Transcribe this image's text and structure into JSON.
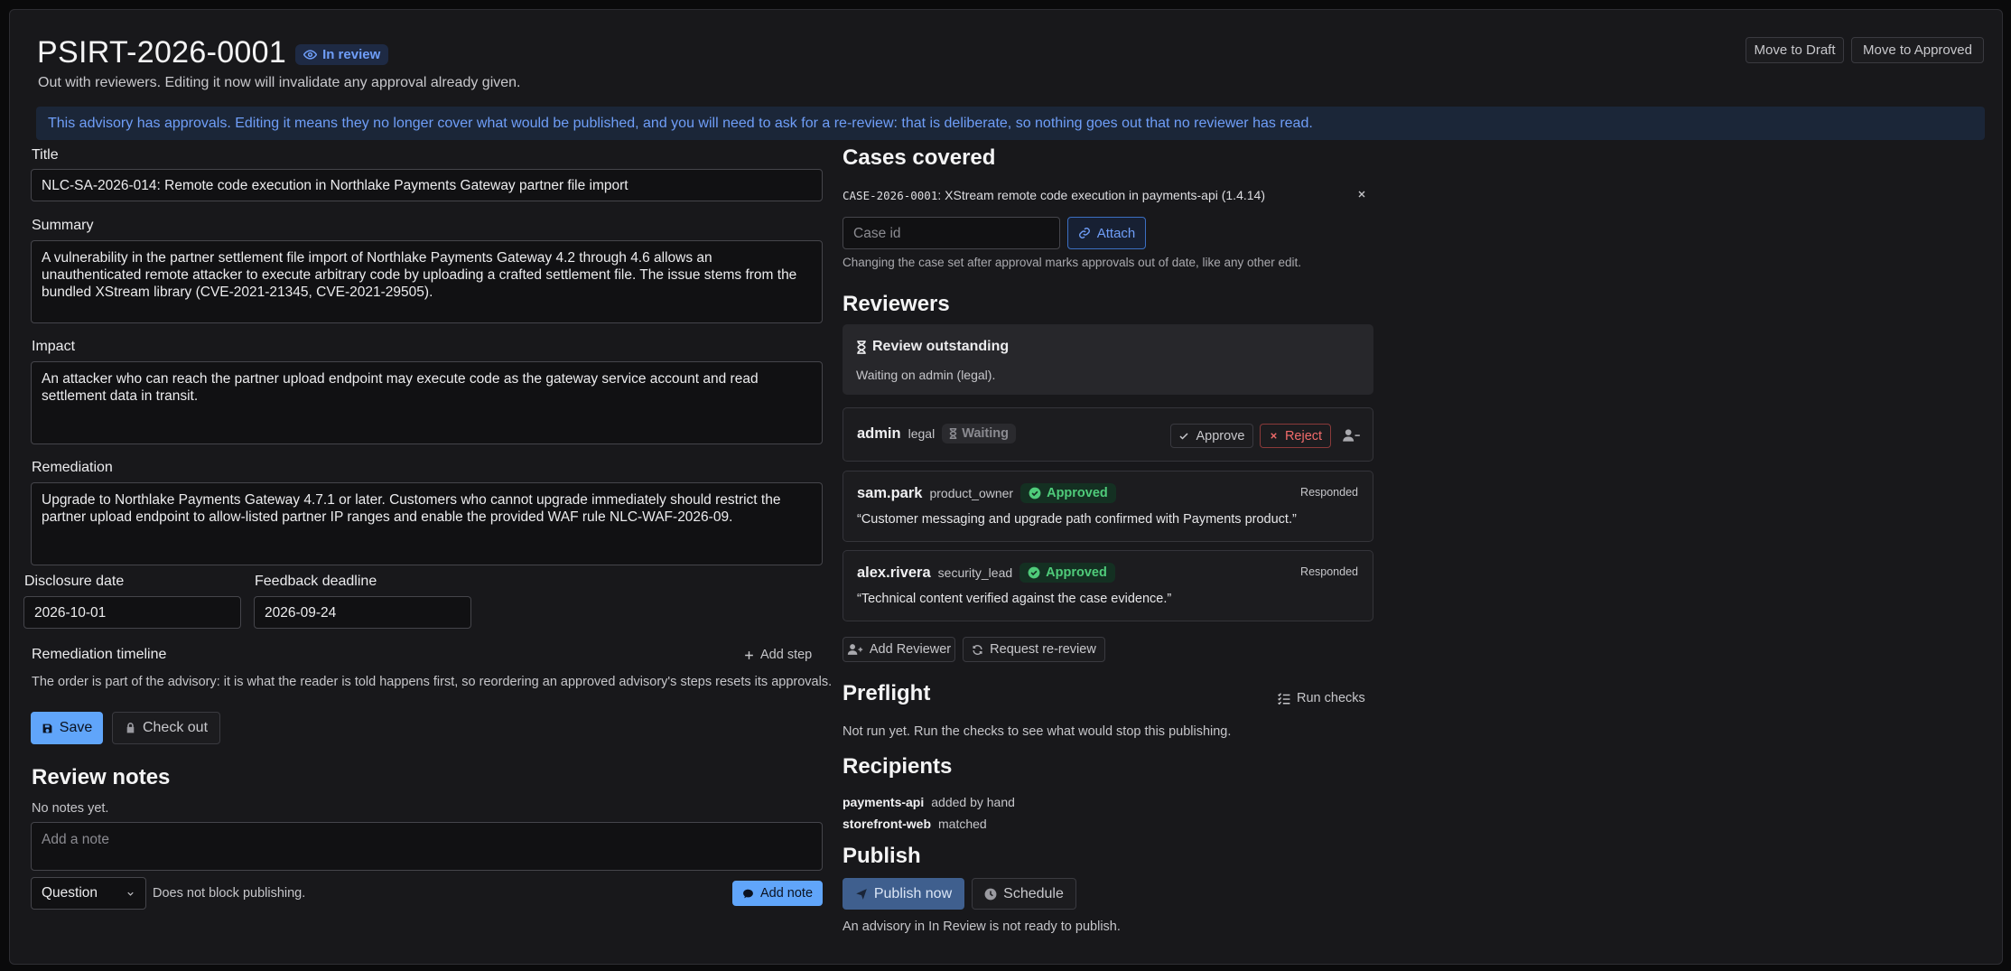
{
  "header": {
    "title": "PSIRT-2026-0001",
    "status_badge": "In review",
    "subtitle": "Out with reviewers. Editing it now will invalidate any approval already given.",
    "move_to_draft": "Move to Draft",
    "move_to_approved": "Move to Approved"
  },
  "banner": {
    "text": "This advisory has approvals. Editing it means they no longer cover what would be published, and you will need to ask for a re-review: that is deliberate, so nothing goes out that no reviewer has read."
  },
  "form": {
    "title_label": "Title",
    "title_value": "NLC-SA-2026-014: Remote code execution in Northlake Payments Gateway partner file import",
    "summary_label": "Summary",
    "summary_value": "A vulnerability in the partner settlement file import of Northlake Payments Gateway 4.2 through 4.6 allows an unauthenticated remote attacker to execute arbitrary code by uploading a crafted settlement file. The issue stems from the bundled XStream library (CVE-2021-21345, CVE-2021-29505).",
    "impact_label": "Impact",
    "impact_value": "An attacker who can reach the partner upload endpoint may execute code as the gateway service account and read settlement data in transit.",
    "remediation_label": "Remediation",
    "remediation_value": "Upgrade to Northlake Payments Gateway 4.7.1 or later. Customers who cannot upgrade immediately should restrict the partner upload endpoint to allow-listed partner IP ranges and enable the provided WAF rule NLC-WAF-2026-09.",
    "disclosure_label": "Disclosure date",
    "disclosure_value": "2026-10-01",
    "feedback_label": "Feedback deadline",
    "feedback_value": "2026-09-24",
    "timeline_label": "Remediation timeline",
    "add_step": "Add step",
    "timeline_note": "The order is part of the advisory: it is what the reader is told happens first, so reordering an approved advisory's steps resets its approvals.",
    "save": "Save",
    "check_out": "Check out"
  },
  "notes": {
    "title": "Review notes",
    "empty": "No notes yet.",
    "placeholder": "Add a note",
    "type_selected": "Question",
    "type_hint": "Does not block publishing.",
    "add_note": "Add note"
  },
  "cases": {
    "title": "Cases covered",
    "items": [
      {
        "id": "CASE-2026-0001",
        "description": ": XStream remote code execution in payments-api (1.4.14)"
      }
    ],
    "input_placeholder": "Case id",
    "attach": "Attach",
    "hint": "Changing the case set after approval marks approvals out of date, like any other edit."
  },
  "reviewers": {
    "title": "Reviewers",
    "outstanding_title": "Review outstanding",
    "outstanding_text": "Waiting on admin (legal).",
    "items": [
      {
        "name": "admin",
        "role": "legal",
        "status": "Waiting",
        "approve": "Approve",
        "reject": "Reject"
      },
      {
        "name": "sam.park",
        "role": "product_owner",
        "status": "Approved",
        "responded": "Responded",
        "comment": "“Customer messaging and upgrade path confirmed with Payments product.”"
      },
      {
        "name": "alex.rivera",
        "role": "security_lead",
        "status": "Approved",
        "responded": "Responded",
        "comment": "“Technical content verified against the case evidence.”"
      }
    ],
    "add_reviewer": "Add Reviewer",
    "request_rereview": "Request re-review"
  },
  "preflight": {
    "title": "Preflight",
    "run_checks": "Run checks",
    "text": "Not run yet. Run the checks to see what would stop this publishing."
  },
  "recipients": {
    "title": "Recipients",
    "items": [
      {
        "name": "payments-api",
        "how": "added by hand"
      },
      {
        "name": "storefront-web",
        "how": "matched"
      }
    ]
  },
  "publish": {
    "title": "Publish",
    "publish_now": "Publish now",
    "schedule": "Schedule",
    "note": "An advisory in In Review is not ready to publish."
  },
  "colors": {
    "accent": "#60a5fa",
    "info_text": "#6f9ef8",
    "approved": "#4fcb7a",
    "reject": "#f26b6b"
  }
}
